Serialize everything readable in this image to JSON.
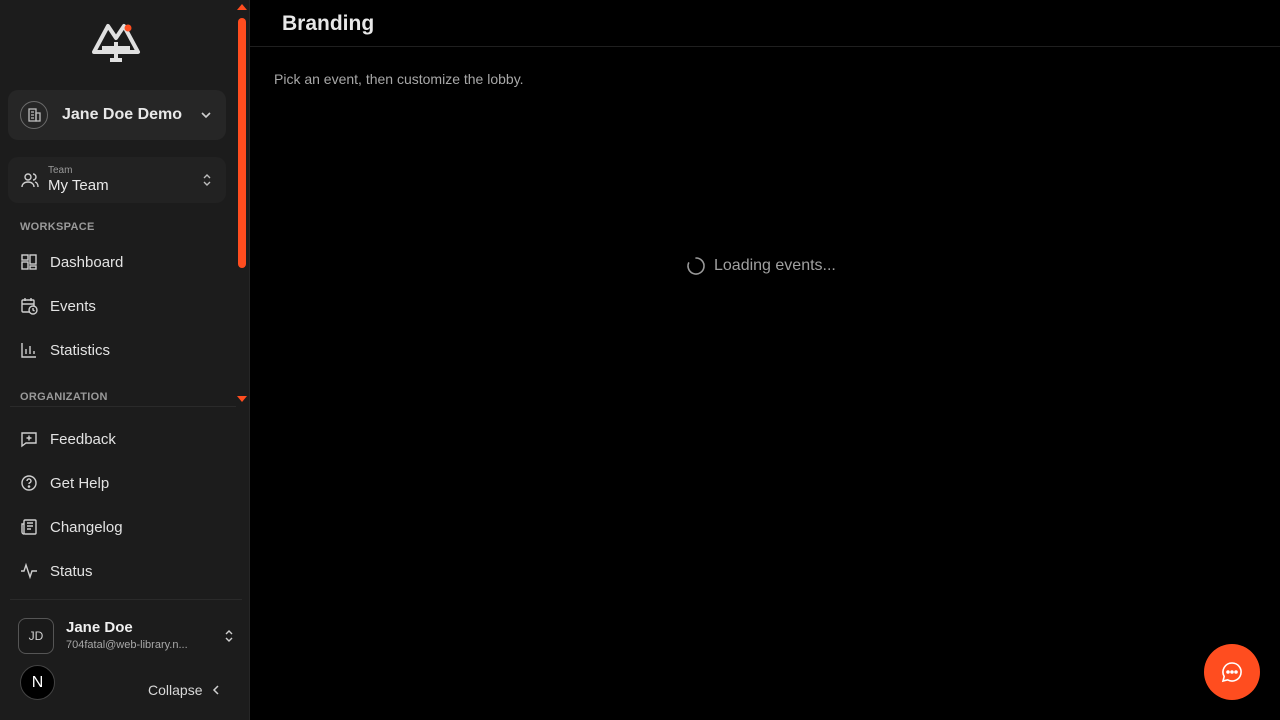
{
  "sidebar": {
    "org_name": "Jane Doe Demo",
    "team": {
      "caption": "Team",
      "name": "My Team"
    },
    "sections": {
      "workspace": "WORKSPACE",
      "organization": "ORGANIZATION"
    },
    "workspace_items": [
      {
        "label": "Dashboard",
        "icon": "dashboard-icon"
      },
      {
        "label": "Events",
        "icon": "calendar-clock-icon"
      },
      {
        "label": "Statistics",
        "icon": "bar-chart-icon"
      }
    ],
    "organization_items": [
      {
        "label": "Feedback",
        "icon": "feedback-icon"
      },
      {
        "label": "Get Help",
        "icon": "help-circle-icon"
      },
      {
        "label": "Changelog",
        "icon": "newspaper-icon"
      },
      {
        "label": "Status",
        "icon": "activity-icon"
      }
    ],
    "user": {
      "initials": "JD",
      "name": "Jane Doe",
      "email": "704fatal@web-library.n..."
    },
    "n_badge": "N",
    "collapse_label": "Collapse"
  },
  "main": {
    "title": "Branding",
    "subtitle": "Pick an event, then customize the lobby.",
    "loading_text": "Loading events..."
  },
  "colors": {
    "accent": "#ff4d1f",
    "sidebar_bg": "#1c1c1c",
    "main_bg": "#000000"
  }
}
